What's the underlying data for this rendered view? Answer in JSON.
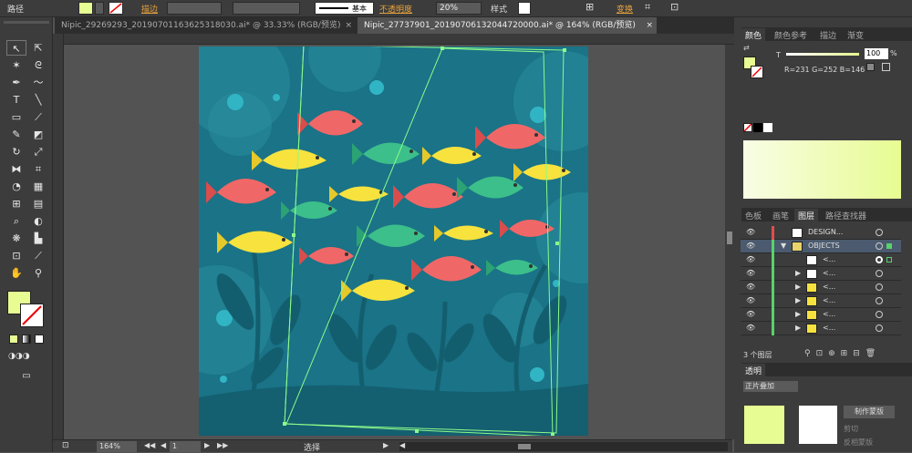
{
  "control_bar": {
    "selection": "路径",
    "stroke_label": "描边",
    "stroke_style": "基本",
    "opacity_label": "不透明度",
    "opacity_value": "20%",
    "style_label": "样式",
    "transform_label": "变换"
  },
  "tabs": [
    {
      "label": "Nipic_29269293_20190701163625318030.ai* @ 33.33% (RGB/预览)"
    },
    {
      "label": "Nipic_27737901_20190706132044720000.ai* @ 164% (RGB/预览)"
    }
  ],
  "status_bar": {
    "zoom": "164%",
    "artboard": "1",
    "tool": "选择"
  },
  "color_panel": {
    "tabs": [
      "颜色",
      "颜色参考",
      "描边",
      "渐变"
    ],
    "opacity": "100",
    "values": "R=231 G=252 B=146",
    "fill_color": "#E7FC92"
  },
  "layers_panel": {
    "tabs": [
      "色板",
      "画笔",
      "图层",
      "路径查找器"
    ],
    "layers": [
      "DESIGN...",
      "OBJECTS",
      "<...",
      "<...",
      "<...",
      "<...",
      "<...",
      "<..."
    ],
    "count": "3 个图层"
  },
  "transparency_panel": {
    "tab": "透明",
    "mode": "正片叠加",
    "make_mask": "制作蒙版",
    "clip": "剪切",
    "invert": "反相蒙版"
  },
  "colors": {
    "accent": "#E7FC92",
    "artboard_bg": "#1A7387",
    "selection": "#8BFB8A"
  }
}
